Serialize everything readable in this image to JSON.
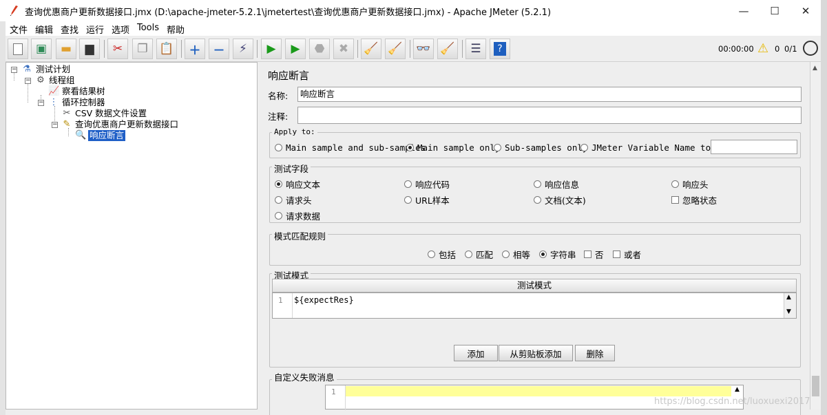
{
  "title_bar": {
    "title": "查询优惠商户更新数据接口.jmx (D:\\apache-jmeter-5.2.1\\jmetertest\\查询优惠商户更新数据接口.jmx) - Apache JMeter (5.2.1)",
    "minimize": "—",
    "maximize": "☐",
    "close": "✕"
  },
  "menu": [
    "文件",
    "编辑",
    "查找",
    "运行",
    "选项",
    "Tools",
    "帮助"
  ],
  "toolbar": {
    "elapsed": "00:00:00",
    "warnings": "0",
    "threads": "0/1"
  },
  "tree": {
    "nodes": [
      {
        "label": "测试计划",
        "icon": "test-plan-icon"
      },
      {
        "label": "线程组",
        "icon": "gear-icon"
      },
      {
        "label": "察看结果树",
        "icon": "results-tree-icon"
      },
      {
        "label": "循环控制器",
        "icon": "loop-controller-icon"
      },
      {
        "label": "CSV 数据文件设置",
        "icon": "csv-config-icon"
      },
      {
        "label": "查询优惠商户更新数据接口",
        "icon": "http-sampler-icon"
      },
      {
        "label": "响应断言",
        "icon": "assertion-icon"
      }
    ]
  },
  "panel": {
    "heading": "响应断言",
    "name_label": "名称:",
    "name_value": "响应断言",
    "comment_label": "注释:",
    "comment_value": "",
    "apply_to": {
      "title": "Apply to:",
      "options": [
        "Main sample and sub-samples",
        "Main sample only",
        "Sub-samples only",
        "JMeter Variable Name to use"
      ],
      "selected": "Main sample only",
      "variable_value": ""
    },
    "field_to_test": {
      "title": "测试字段",
      "options": [
        "响应文本",
        "响应代码",
        "响应信息",
        "响应头",
        "请求头",
        "URL样本",
        "文档(文本)",
        "忽略状态",
        "请求数据"
      ],
      "selected": "响应文本",
      "ignore_status_checked": false
    },
    "matching_rules": {
      "title": "模式匹配规则",
      "options": [
        "包括",
        "匹配",
        "相等",
        "字符串",
        "否",
        "或者"
      ],
      "selected": "字符串",
      "not_checked": false,
      "or_checked": false
    },
    "patterns": {
      "title": "测试模式",
      "column_header": "测试模式",
      "rows": [
        {
          "line": "1",
          "value": "${expectRes}"
        }
      ]
    },
    "buttons": {
      "add": "添加",
      "add_from_clipboard": "从剪贴板添加",
      "delete": "删除"
    },
    "custom_failure": {
      "title": "自定义失败消息",
      "rows": [
        {
          "line": "1",
          "value": ""
        }
      ]
    }
  },
  "watermark": "https://blog.csdn.net/luoxuexi2017"
}
